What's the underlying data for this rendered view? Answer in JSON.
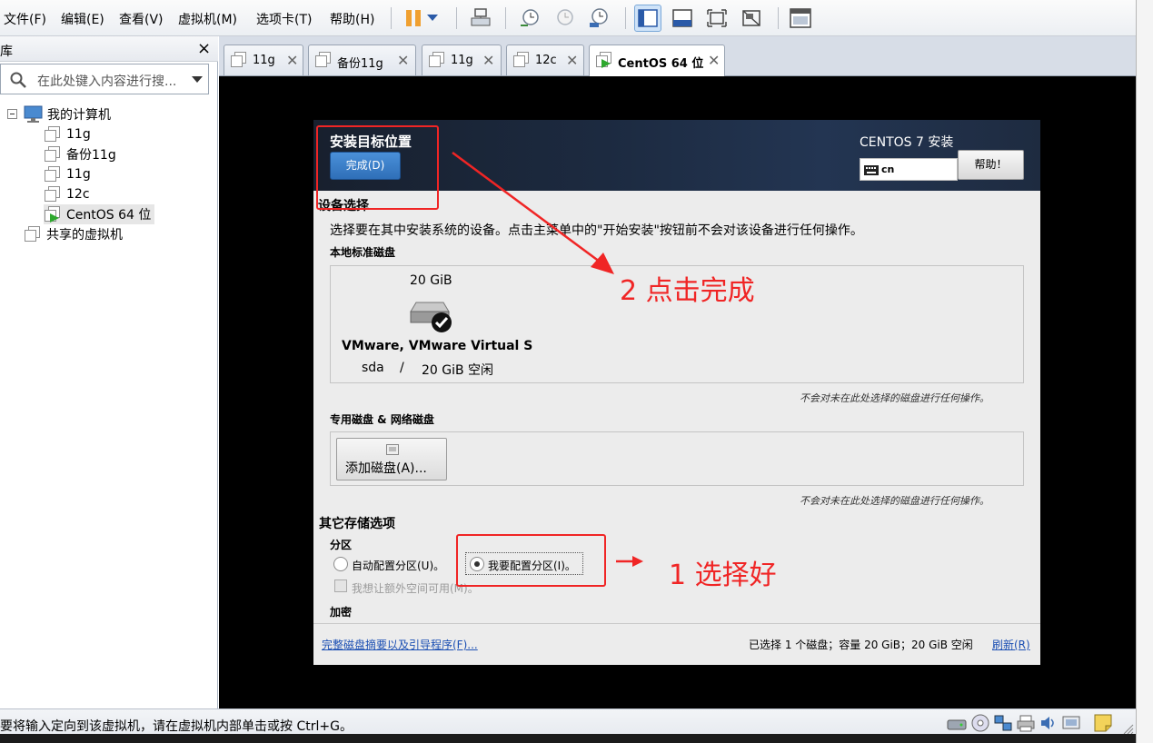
{
  "menubar": {
    "items": [
      "文件(F)",
      "编辑(E)",
      "查看(V)",
      "虚拟机(M)",
      "选项卡(T)",
      "帮助(H)"
    ]
  },
  "library": {
    "title": "库",
    "close": "×",
    "search_placeholder": "在此处键入内容进行搜...",
    "tree": {
      "root": "我的计算机",
      "vms": [
        "11g",
        "备份11g",
        "11g",
        "12c",
        "CentOS 64 位"
      ],
      "shared": "共享的虚拟机"
    }
  },
  "tabs": [
    {
      "label": "11g"
    },
    {
      "label": "备份11g"
    },
    {
      "label": "11g"
    },
    {
      "label": "12c"
    },
    {
      "label": "CentOS 64 位",
      "active": true
    }
  ],
  "installer": {
    "title": "安装目标位置",
    "done_button": "完成(D)",
    "product": "CENTOS 7 安装",
    "keyboard": "cn",
    "help_button": "帮助！",
    "device_selection": "设备选择",
    "device_desc": "选择要在其中安装系统的设备。点击主菜单中的\"开始安装\"按钮前不会对该设备进行任何操作。",
    "local_disks": "本地标准磁盘",
    "disk": {
      "size": "20 GiB",
      "name": "VMware, VMware Virtual S",
      "dev": "sda",
      "sep": "/",
      "free": "20 GiB 空闲"
    },
    "note": "不会对未在此处选择的磁盘进行任何操作。",
    "special_disks": "专用磁盘 & 网络磁盘",
    "add_disk_button": "添加磁盘(A)...",
    "other_storage": "其它存储选项",
    "partition": "分区",
    "auto_partition": "自动配置分区(U)。",
    "manual_partition": "我要配置分区(I)。",
    "extra_space": "我想让额外空间可用(M)。",
    "encryption": "加密",
    "summary_link": "完整磁盘摘要以及引导程序(F)...",
    "selection_status": "已选择 1 个磁盘；容量 20 GiB；20 GiB 空闲",
    "refresh_link": "刷新(R)"
  },
  "annotations": {
    "step1": "1 选择好",
    "step2": "2 点击完成"
  },
  "statusbar": {
    "text": "要将输入定向到该虚拟机，请在虚拟机内部单击或按 Ctrl+G。"
  },
  "colors": {
    "annotation_red": "#f02525",
    "installer_header": "#1c2a40",
    "link_blue": "#1b4fb3"
  }
}
